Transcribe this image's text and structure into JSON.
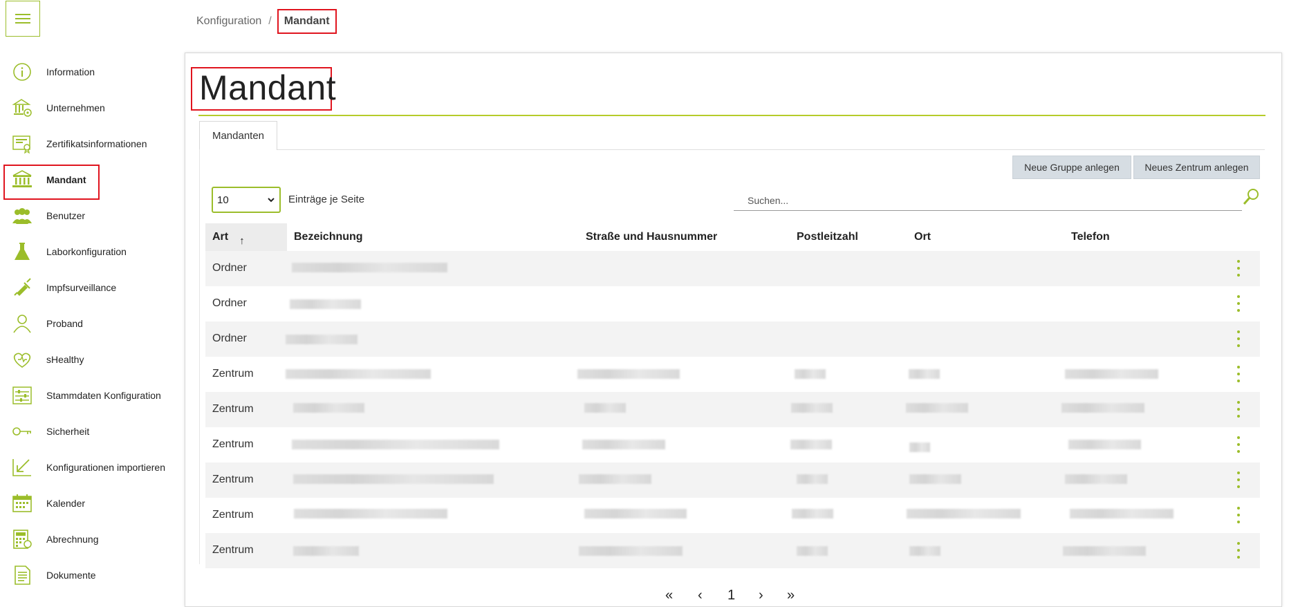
{
  "breadcrumb": {
    "parent": "Konfiguration",
    "separator": "/",
    "current": "Mandant"
  },
  "sidebar": {
    "items": [
      {
        "label": "Information",
        "icon": "info-icon"
      },
      {
        "label": "Unternehmen",
        "icon": "bank-gear-icon"
      },
      {
        "label": "Zertifikatsinformationen",
        "icon": "certificate-icon"
      },
      {
        "label": "Mandant",
        "icon": "institution-icon",
        "active": true
      },
      {
        "label": "Benutzer",
        "icon": "users-icon"
      },
      {
        "label": "Laborkonfiguration",
        "icon": "flask-icon"
      },
      {
        "label": "Impfsurveillance",
        "icon": "syringe-icon"
      },
      {
        "label": "Proband",
        "icon": "person-icon"
      },
      {
        "label": "sHealthy",
        "icon": "heart-stethoscope-icon"
      },
      {
        "label": "Stammdaten Konfiguration",
        "icon": "sliders-icon"
      },
      {
        "label": "Sicherheit",
        "icon": "key-icon"
      },
      {
        "label": "Konfigurationen importieren",
        "icon": "import-arrow-icon"
      },
      {
        "label": "Kalender",
        "icon": "calendar-icon"
      },
      {
        "label": "Abrechnung",
        "icon": "calculator-icon"
      },
      {
        "label": "Dokumente",
        "icon": "document-icon"
      }
    ]
  },
  "main": {
    "title": "Mandant",
    "tab_label": "Mandanten",
    "btn_new_group": "Neue Gruppe anlegen",
    "btn_new_center": "Neues Zentrum anlegen",
    "page_size": "10",
    "per_page_label": "Einträge je Seite",
    "search_placeholder": "Suchen...",
    "sort_indicator": "↑"
  },
  "table": {
    "columns": [
      "Art",
      "Bezeichnung",
      "Straße und Hausnummer",
      "Postleitzahl",
      "Ort",
      "Telefon"
    ],
    "rows": [
      {
        "art": "Ordner"
      },
      {
        "art": "Ordner"
      },
      {
        "art": "Ordner"
      },
      {
        "art": "Zentrum"
      },
      {
        "art": "Zentrum"
      },
      {
        "art": "Zentrum"
      },
      {
        "art": "Zentrum"
      },
      {
        "art": "Zentrum"
      },
      {
        "art": "Zentrum"
      }
    ]
  },
  "pagination": {
    "first": "«",
    "prev": "‹",
    "current": "1",
    "next": "›",
    "last": "»"
  },
  "colors": {
    "accent": "#9bbd2a",
    "highlight_frame": "#e0141e",
    "button_bg": "#d6dde3"
  }
}
